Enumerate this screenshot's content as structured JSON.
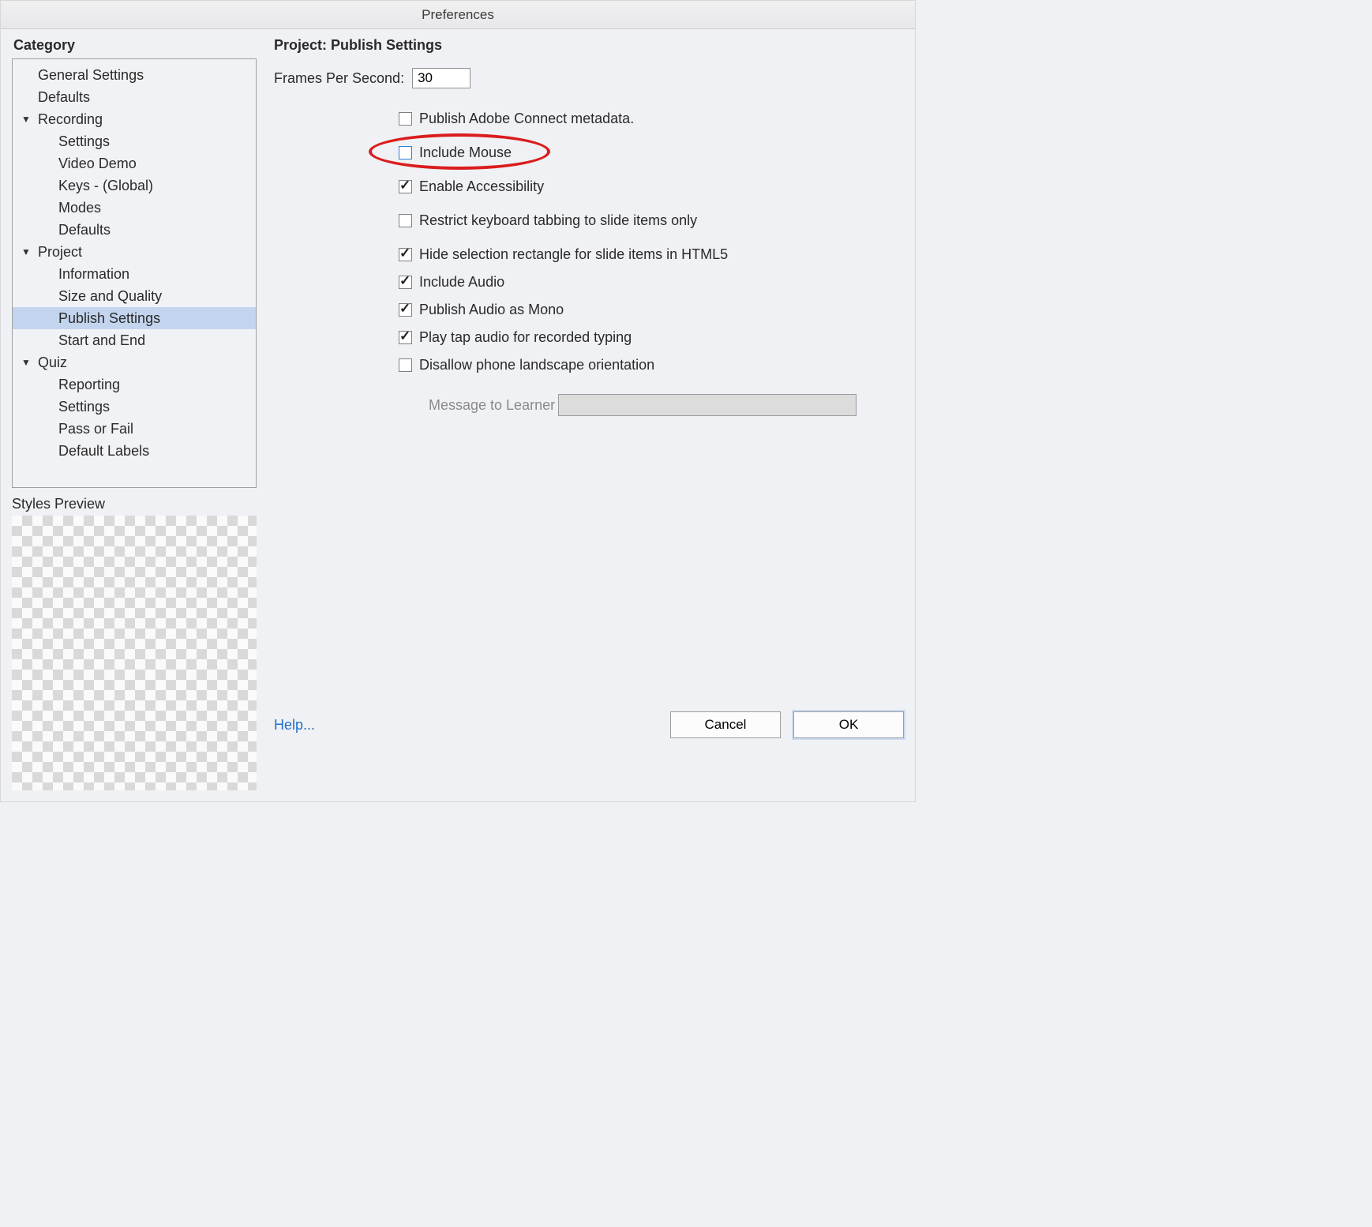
{
  "window": {
    "title": "Preferences"
  },
  "sidebar": {
    "heading": "Category",
    "items": [
      {
        "label": "General Settings",
        "level": 1
      },
      {
        "label": "Defaults",
        "level": 1
      },
      {
        "label": "Recording",
        "level": 1,
        "caret": true
      },
      {
        "label": "Settings",
        "level": 2
      },
      {
        "label": "Video Demo",
        "level": 2
      },
      {
        "label": "Keys - (Global)",
        "level": 2
      },
      {
        "label": "Modes",
        "level": 2
      },
      {
        "label": "Defaults",
        "level": 2
      },
      {
        "label": "Project",
        "level": 1,
        "caret": true
      },
      {
        "label": "Information",
        "level": 2
      },
      {
        "label": "Size and Quality",
        "level": 2
      },
      {
        "label": "Publish Settings",
        "level": 2,
        "selected": true
      },
      {
        "label": "Start and End",
        "level": 2
      },
      {
        "label": "Quiz",
        "level": 1,
        "caret": true
      },
      {
        "label": "Reporting",
        "level": 2
      },
      {
        "label": "Settings",
        "level": 2
      },
      {
        "label": "Pass or Fail",
        "level": 2
      },
      {
        "label": "Default Labels",
        "level": 2
      }
    ],
    "styles_preview": "Styles Preview"
  },
  "panel": {
    "title": "Project: Publish Settings",
    "fps_label": "Frames Per Second:",
    "fps_value": "30",
    "options": [
      {
        "key": "connect",
        "label": "Publish Adobe Connect metadata.",
        "checked": false,
        "gap": true
      },
      {
        "key": "mouse",
        "label": "Include Mouse",
        "checked": false,
        "gap": true,
        "highlight": true,
        "blue": true
      },
      {
        "key": "access",
        "label": "Enable Accessibility",
        "checked": true,
        "gap": true
      },
      {
        "key": "tabbing",
        "label": "Restrict keyboard tabbing to slide items only",
        "checked": false,
        "gap": true
      },
      {
        "key": "hiderect",
        "label": "Hide selection rectangle for slide items in HTML5",
        "checked": true
      },
      {
        "key": "audio",
        "label": "Include Audio",
        "checked": true
      },
      {
        "key": "mono",
        "label": "Publish Audio as Mono",
        "checked": true
      },
      {
        "key": "tap",
        "label": "Play tap audio for recorded typing",
        "checked": true
      },
      {
        "key": "landscape",
        "label": "Disallow phone landscape orientation",
        "checked": false
      }
    ],
    "message_label": "Message to Learner",
    "message_value": ""
  },
  "footer": {
    "help": "Help...",
    "cancel": "Cancel",
    "ok": "OK"
  }
}
